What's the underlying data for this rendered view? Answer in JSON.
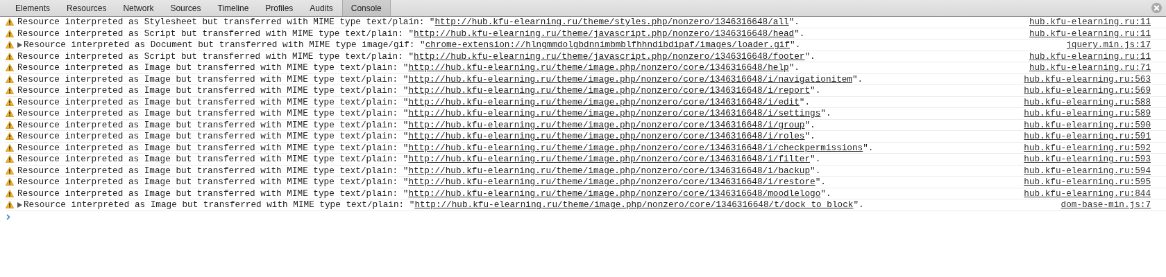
{
  "tabs": [
    {
      "label": "Elements",
      "selected": false
    },
    {
      "label": "Resources",
      "selected": false
    },
    {
      "label": "Network",
      "selected": false
    },
    {
      "label": "Sources",
      "selected": false
    },
    {
      "label": "Timeline",
      "selected": false
    },
    {
      "label": "Profiles",
      "selected": false
    },
    {
      "label": "Audits",
      "selected": false
    },
    {
      "label": "Console",
      "selected": true
    }
  ],
  "messages": [
    {
      "expandable": false,
      "text": "Resource interpreted as Stylesheet but transferred with MIME type text/plain: \"",
      "url": "http://hub.kfu-elearning.ru/theme/styles.php/nonzero/1346316648/all",
      "suffix": "\".",
      "source": "hub.kfu-elearning.ru:11"
    },
    {
      "expandable": false,
      "text": "Resource interpreted as Script but transferred with MIME type text/plain: \"",
      "url": "http://hub.kfu-elearning.ru/theme/javascript.php/nonzero/1346316648/head",
      "suffix": "\".",
      "source": "hub.kfu-elearning.ru:11"
    },
    {
      "expandable": true,
      "text": "Resource interpreted as Document but transferred with MIME type image/gif: \"",
      "url": "chrome-extension://hlngmmdolgbdnnimbmblfhhndibdipaf/images/loader.gif",
      "suffix": "\".",
      "source": "jquery.min.js:17"
    },
    {
      "expandable": false,
      "text": "Resource interpreted as Script but transferred with MIME type text/plain: \"",
      "url": "http://hub.kfu-elearning.ru/theme/javascript.php/nonzero/1346316648/footer",
      "suffix": "\".",
      "source": "hub.kfu-elearning.ru:11"
    },
    {
      "expandable": false,
      "text": "Resource interpreted as Image but transferred with MIME type text/plain: \"",
      "url": "http://hub.kfu-elearning.ru/theme/image.php/nonzero/core/1346316648/help",
      "suffix": "\".",
      "source": "hub.kfu-elearning.ru:71"
    },
    {
      "expandable": false,
      "text": "Resource interpreted as Image but transferred with MIME type text/plain: \"",
      "url": "http://hub.kfu-elearning.ru/theme/image.php/nonzero/core/1346316648/i/navigationitem",
      "suffix": "\".",
      "source": "hub.kfu-elearning.ru:563"
    },
    {
      "expandable": false,
      "text": "Resource interpreted as Image but transferred with MIME type text/plain: \"",
      "url": "http://hub.kfu-elearning.ru/theme/image.php/nonzero/core/1346316648/i/report",
      "suffix": "\".",
      "source": "hub.kfu-elearning.ru:569"
    },
    {
      "expandable": false,
      "text": "Resource interpreted as Image but transferred with MIME type text/plain: \"",
      "url": "http://hub.kfu-elearning.ru/theme/image.php/nonzero/core/1346316648/i/edit",
      "suffix": "\".",
      "source": "hub.kfu-elearning.ru:588"
    },
    {
      "expandable": false,
      "text": "Resource interpreted as Image but transferred with MIME type text/plain: \"",
      "url": "http://hub.kfu-elearning.ru/theme/image.php/nonzero/core/1346316648/i/settings",
      "suffix": "\".",
      "source": "hub.kfu-elearning.ru:589"
    },
    {
      "expandable": false,
      "text": "Resource interpreted as Image but transferred with MIME type text/plain: \"",
      "url": "http://hub.kfu-elearning.ru/theme/image.php/nonzero/core/1346316648/i/group",
      "suffix": "\".",
      "source": "hub.kfu-elearning.ru:590"
    },
    {
      "expandable": false,
      "text": "Resource interpreted as Image but transferred with MIME type text/plain: \"",
      "url": "http://hub.kfu-elearning.ru/theme/image.php/nonzero/core/1346316648/i/roles",
      "suffix": "\".",
      "source": "hub.kfu-elearning.ru:591"
    },
    {
      "expandable": false,
      "text": "Resource interpreted as Image but transferred with MIME type text/plain: \"",
      "url": "http://hub.kfu-elearning.ru/theme/image.php/nonzero/core/1346316648/i/checkpermissions",
      "suffix": "\".",
      "source": "hub.kfu-elearning.ru:592"
    },
    {
      "expandable": false,
      "text": "Resource interpreted as Image but transferred with MIME type text/plain: \"",
      "url": "http://hub.kfu-elearning.ru/theme/image.php/nonzero/core/1346316648/i/filter",
      "suffix": "\".",
      "source": "hub.kfu-elearning.ru:593"
    },
    {
      "expandable": false,
      "text": "Resource interpreted as Image but transferred with MIME type text/plain: \"",
      "url": "http://hub.kfu-elearning.ru/theme/image.php/nonzero/core/1346316648/i/backup",
      "suffix": "\".",
      "source": "hub.kfu-elearning.ru:594"
    },
    {
      "expandable": false,
      "text": "Resource interpreted as Image but transferred with MIME type text/plain: \"",
      "url": "http://hub.kfu-elearning.ru/theme/image.php/nonzero/core/1346316648/i/restore",
      "suffix": "\".",
      "source": "hub.kfu-elearning.ru:595"
    },
    {
      "expandable": false,
      "text": "Resource interpreted as Image but transferred with MIME type text/plain: \"",
      "url": "http://hub.kfu-elearning.ru/theme/image.php/nonzero/core/1346316648/moodlelogo",
      "suffix": "\".",
      "source": "hub.kfu-elearning.ru:844"
    },
    {
      "expandable": true,
      "text": "Resource interpreted as Image but transferred with MIME type text/plain: \"",
      "url": "http://hub.kfu-elearning.ru/theme/image.php/nonzero/core/1346316648/t/dock_to_block",
      "suffix": "\".",
      "source": "dom-base-min.js:7"
    }
  ]
}
